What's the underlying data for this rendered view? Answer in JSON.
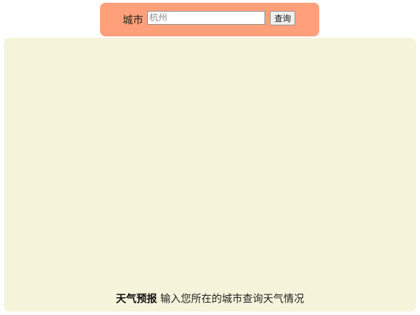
{
  "search": {
    "label": "城市",
    "placeholder": "杭州",
    "value": "",
    "button_label": "查询"
  },
  "intro": {
    "title": "天气预报",
    "description": "输入您所在的城市查询天气情况"
  },
  "colors": {
    "search_bar_bg": "#ffa07a",
    "panel_bg": "#f5f3da",
    "map_gradient": [
      "#e6dc5a",
      "#d9b59a",
      "#c97aa6",
      "#9a4fb0",
      "#8e7fc8"
    ]
  },
  "icons": {
    "map_illustration": "china-map-scribble-icon"
  }
}
